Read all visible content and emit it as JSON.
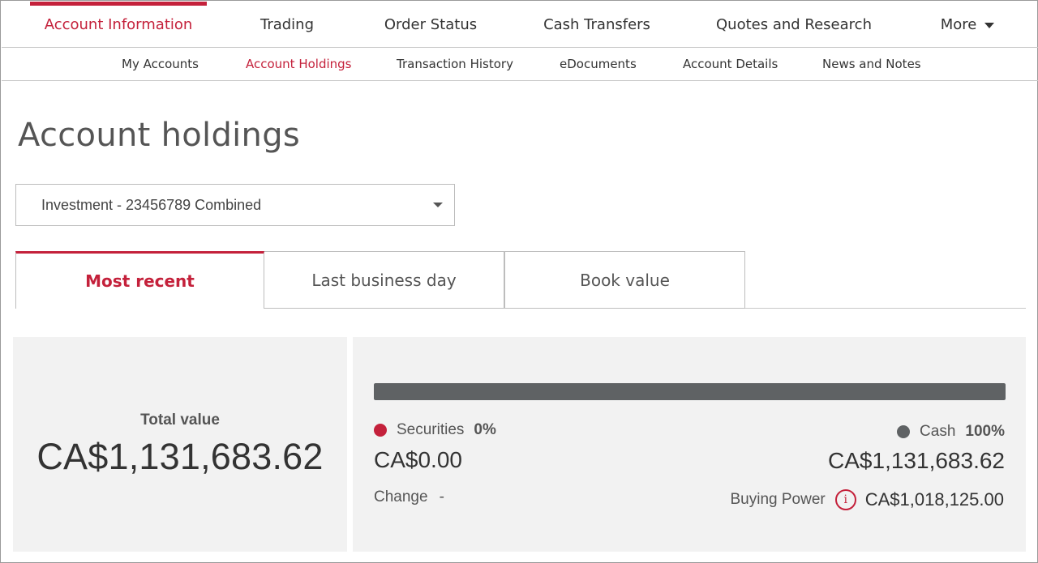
{
  "top_nav": [
    {
      "label": "Account Information",
      "active": true
    },
    {
      "label": "Trading",
      "active": false
    },
    {
      "label": "Order Status",
      "active": false
    },
    {
      "label": "Cash Transfers",
      "active": false
    },
    {
      "label": "Quotes and Research",
      "active": false
    },
    {
      "label": "More",
      "active": false
    }
  ],
  "sub_nav": [
    {
      "label": "My Accounts",
      "active": false
    },
    {
      "label": "Account Holdings",
      "active": true
    },
    {
      "label": "Transaction History",
      "active": false
    },
    {
      "label": "eDocuments",
      "active": false
    },
    {
      "label": "Account Details",
      "active": false
    },
    {
      "label": "News and Notes",
      "active": false
    }
  ],
  "page_title": "Account holdings",
  "account_select": {
    "selected": "Investment - 23456789 Combined"
  },
  "tabs": [
    {
      "label": "Most recent",
      "active": true
    },
    {
      "label": "Last business day",
      "active": false
    },
    {
      "label": "Book value",
      "active": false
    }
  ],
  "summary": {
    "total_label": "Total value",
    "total_value": "CA$1,131,683.62"
  },
  "allocation": {
    "securities": {
      "label": "Securities",
      "percent_text": "0%",
      "fraction": 0.0,
      "amount": "CA$0.00"
    },
    "cash": {
      "label": "Cash",
      "percent_text": "100%",
      "fraction": 1.0,
      "amount": "CA$1,131,683.62"
    },
    "change_label": "Change",
    "change_value": "-",
    "buying_power_label": "Buying Power",
    "buying_power_value": "CA$1,018,125.00"
  },
  "colors": {
    "accent": "#c4213b",
    "cash": "#5f6264",
    "panel_bg": "#f2f2f2"
  },
  "icons": {
    "more_caret": "chevron-down-icon",
    "select_caret": "chevron-down-icon",
    "info": "info-icon"
  }
}
